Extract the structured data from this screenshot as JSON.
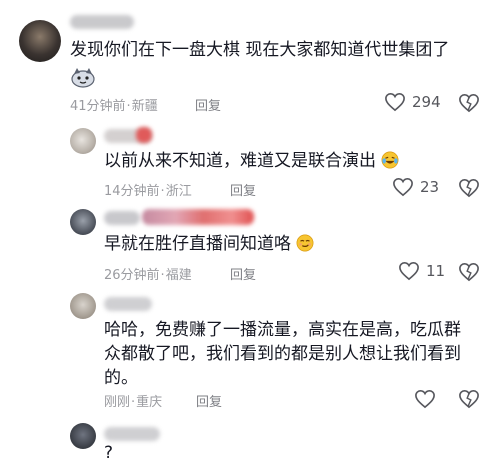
{
  "comments": [
    {
      "text": "发现你们在下一盘大棋 现在大家都知道代世集团了",
      "time": "41分钟前",
      "location": "新疆",
      "reply": "回复",
      "likes": "294",
      "has_sticker": true
    },
    {
      "text": "以前从来不知道，难道又是联合演出",
      "time": "14分钟前",
      "location": "浙江",
      "reply": "回复",
      "likes": "23",
      "emoji": "laughing-tears"
    },
    {
      "text": "早就在胜仔直播间知道咯",
      "time": "26分钟前",
      "location": "福建",
      "reply": "回复",
      "likes": "11",
      "emoji": "smirk"
    },
    {
      "text_lines": [
        "哈哈，免费赚了一播流量，高实在是高，吃瓜群",
        "众都散了吧，我们看到的都是别人想让我们看到",
        "的。"
      ],
      "time": "刚刚",
      "location": "重庆",
      "reply": "回复"
    },
    {
      "text": "?"
    }
  ],
  "colors": {
    "meta": "#9a9ba0",
    "text": "#161823",
    "icon": "#56575d"
  }
}
